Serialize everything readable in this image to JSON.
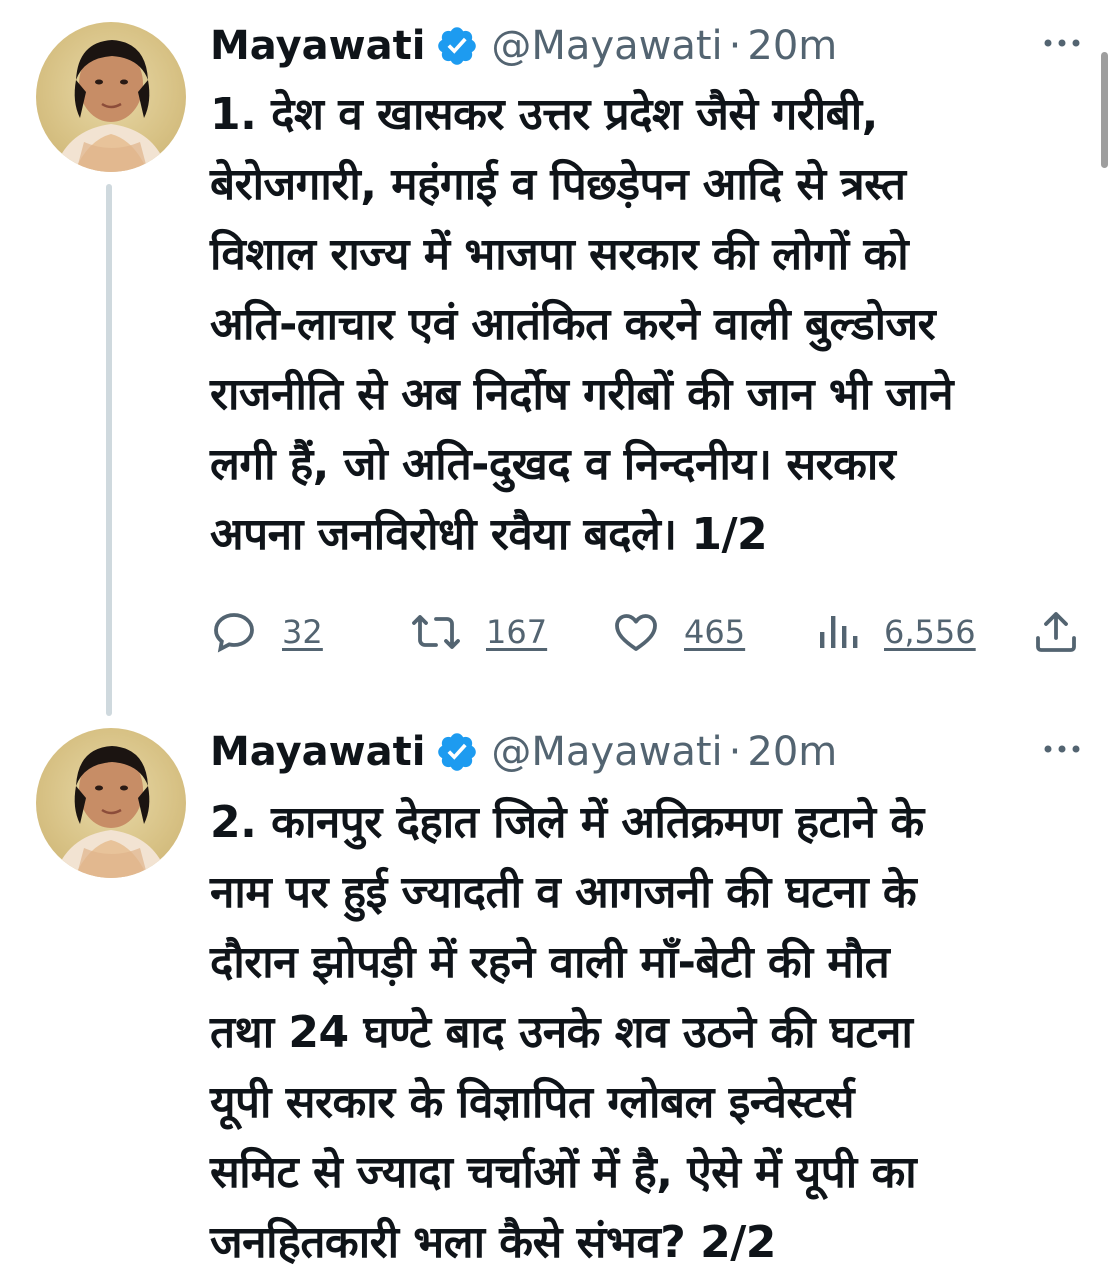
{
  "tweets": [
    {
      "author_name": "Mayawati",
      "handle": "@Mayawati",
      "separator": "·",
      "time": "20m",
      "text": "1. देश व खासकर उत्तर प्रदेश जैसे गरीबी,\nबेरोजगारी, महंगाई व पिछड़ेपन आदि से त्रस्त\nविशाल राज्य में भाजपा सरकार की लोगों को\nअति-लाचार एवं आतंकित करने वाली बुल्डोजर\nराजनीति से अब निर्दोष गरीबों की जान भी जाने\nलगी हैं, जो अति-दुखद व निन्दनीय। सरकार\nअपना जनविरोधी रवैया बदले। 1/2",
      "replies": "32",
      "retweets": "167",
      "likes": "465",
      "views": "6,556"
    },
    {
      "author_name": "Mayawati",
      "handle": "@Mayawati",
      "separator": "·",
      "time": "20m",
      "text": "2. कानपुर देहात जिले में अतिक्रमण हटाने के\nनाम पर हुई ज्यादती व आगजनी की घटना के\nदौरान झोपड़ी में रहने वाली माँ-बेटी की मौत\nतथा 24 घण्टे बाद उनके शव उठने की घटना\nयूपी सरकार के विज्ञापित ग्लोबल इन्वेस्टर्स\nसमिट से ज्यादा चर्चाओं में है, ऐसे में यूपी का\nजनहितकारी भला कैसे संभव? 2/2"
    }
  ],
  "colors": {
    "verified_blue": "#1d9bf0",
    "muted_text": "#536471",
    "thread_line": "#cfd9de"
  },
  "icons": {
    "reply": "reply-icon",
    "retweet": "retweet-icon",
    "like": "heart-icon",
    "views": "views-icon",
    "share": "share-icon",
    "more": "more-dots-icon",
    "verified": "verified-badge-icon"
  }
}
